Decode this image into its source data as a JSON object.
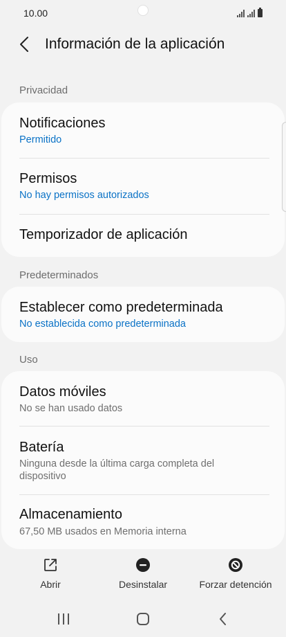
{
  "status_bar": {
    "time": "10.00"
  },
  "header": {
    "title": "Información de la aplicación"
  },
  "sections": {
    "privacy": {
      "label": "Privacidad",
      "items": [
        {
          "title": "Notificaciones",
          "subtitle": "Permitido"
        },
        {
          "title": "Permisos",
          "subtitle": "No hay permisos autorizados"
        },
        {
          "title": "Temporizador de aplicación"
        }
      ]
    },
    "defaults": {
      "label": "Predeterminados",
      "items": [
        {
          "title": "Establecer como predeterminada",
          "subtitle": "No establecida como predeterminada"
        }
      ]
    },
    "usage": {
      "label": "Uso",
      "items": [
        {
          "title": "Datos móviles",
          "subtitle": "No se han usado datos"
        },
        {
          "title": "Batería",
          "subtitle_line1": "Ninguna desde la última carga completa del",
          "subtitle_line2": "dispositivo"
        },
        {
          "title": "Almacenamiento",
          "subtitle": "67,50 MB usados en Memoria interna"
        }
      ]
    }
  },
  "actions": [
    {
      "label": "Abrir",
      "icon": "open-external-icon"
    },
    {
      "label": "Desinstalar",
      "icon": "uninstall-minus-icon"
    },
    {
      "label": "Forzar detención",
      "icon": "force-stop-icon"
    }
  ],
  "nav": {
    "icons": [
      "recents-icon",
      "home-icon",
      "back-nav-icon"
    ]
  },
  "colors": {
    "link_blue": "#0a72c6",
    "background": "#f2f2f2",
    "card": "#fbfbfb"
  }
}
